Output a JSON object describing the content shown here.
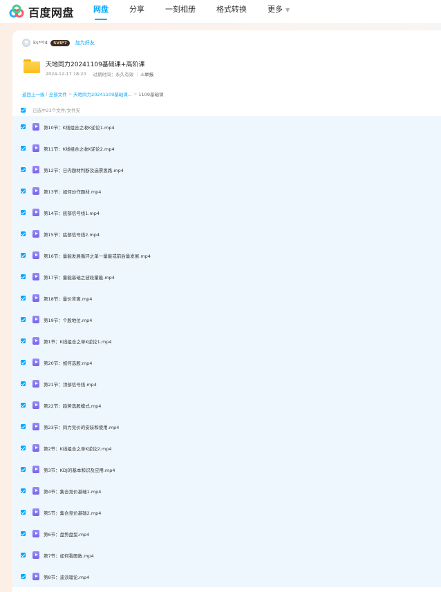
{
  "app": {
    "logo_text": "百度网盘",
    "nav": [
      {
        "label": "网盘",
        "active": true
      },
      {
        "label": "分享",
        "active": false
      },
      {
        "label": "一刻相册",
        "active": false
      },
      {
        "label": "格式转换",
        "active": false
      },
      {
        "label": "更多",
        "active": false
      }
    ]
  },
  "share": {
    "username": "ks**l4",
    "vip_badge": "SVIP7",
    "add_friend": "加为好友",
    "title": "天地同力20241109基础课+高阶课",
    "date": "2024-12-17 18:20",
    "expire": "过期时间：永久有效",
    "report": "举报"
  },
  "breadcrumb": {
    "back": "返回上一级",
    "all": "全部文件",
    "folder": "天地同力20241109基础课...",
    "current": "1109基础课"
  },
  "select_all_label": "已选中23个文件/文件夹",
  "files": [
    "第10节：K线组合之收K逆论1.mp4",
    "第11节：K线组合之收K逆论2.mp4",
    "第12节：日内题材判断及选票思路.mp4",
    "第13节：如何炒作题材.mp4",
    "第14节：底部信号线1.mp4",
    "第15节：底部信号线2.mp4",
    "第16节：量能发展循环之单一量能或前后量发展.mp4",
    "第17节：量能基础之波段量能.mp4",
    "第18节：量价背离.mp4",
    "第19节：个股地位.mp4",
    "第1节：K线组合之单K逆论1.mp4",
    "第20节：如何选股.mp4",
    "第21节：顶部信号线.mp4",
    "第22节：趋势选股模式.mp4",
    "第23节：同力竞价的安装和使用.mp4",
    "第2节：K线组合之单K逆论2.mp4",
    "第3节：KDJ的基本和识及应用.mp4",
    "第4节：集合竞价基础1.mp4",
    "第5节：集合竞价基础2.mp4",
    "第6节：盘势盘型.mp4",
    "第7节：如何看图数.mp4",
    "第8节：波浪理论.mp4"
  ],
  "colors": {
    "accent": "#06a7ff",
    "list_bg": "#eef7fe",
    "video_icon": "#7864ea",
    "folder": "#ffc933"
  }
}
